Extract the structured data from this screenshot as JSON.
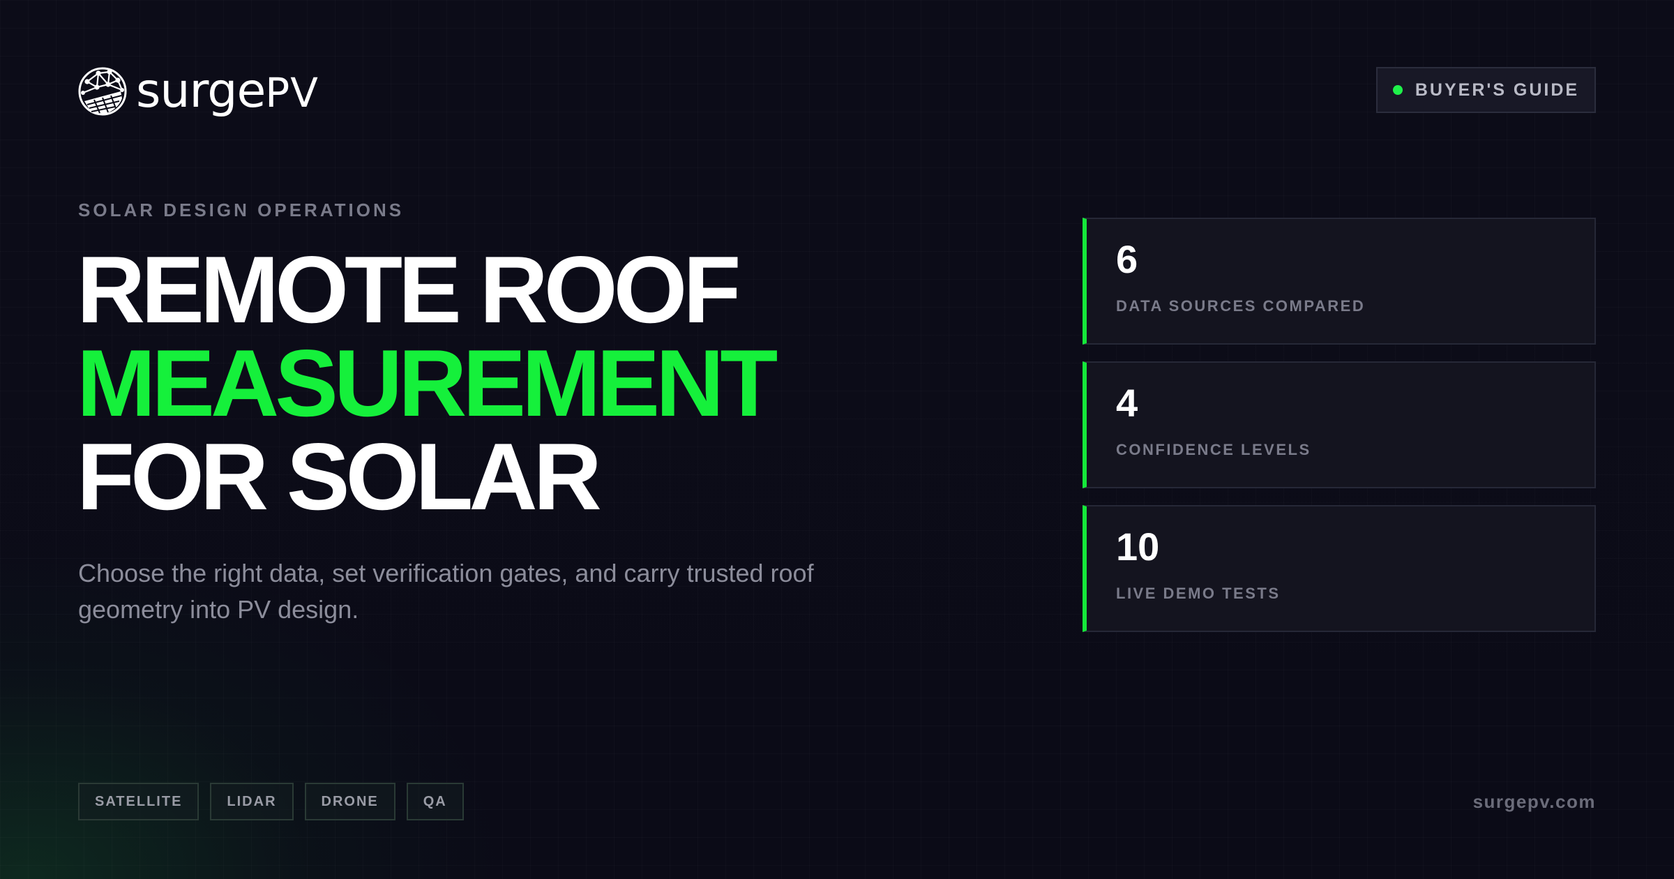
{
  "brand": {
    "logo_icon": "globe-solar-panel-icon",
    "name_prefix": "surge",
    "name_suffix": "PV"
  },
  "badge": {
    "label": "BUYER'S GUIDE",
    "dot_color": "#1ff04a"
  },
  "eyebrow": "SOLAR DESIGN OPERATIONS",
  "headline": {
    "line1": "REMOTE ROOF",
    "line2": "MEASUREMENT",
    "line3": "FOR SOLAR",
    "accent_color": "#15f03b"
  },
  "subtitle": "Choose the right data, set verification gates, and carry trusted roof geometry into PV design.",
  "stats": [
    {
      "value": "6",
      "label": "DATA SOURCES COMPARED"
    },
    {
      "value": "4",
      "label": "CONFIDENCE LEVELS"
    },
    {
      "value": "10",
      "label": "LIVE DEMO TESTS"
    }
  ],
  "tags": [
    "SATELLITE",
    "LIDAR",
    "DRONE",
    "QA"
  ],
  "site": "surgepv.com",
  "colors": {
    "background": "#0b0b17",
    "accent": "#15f03b"
  }
}
